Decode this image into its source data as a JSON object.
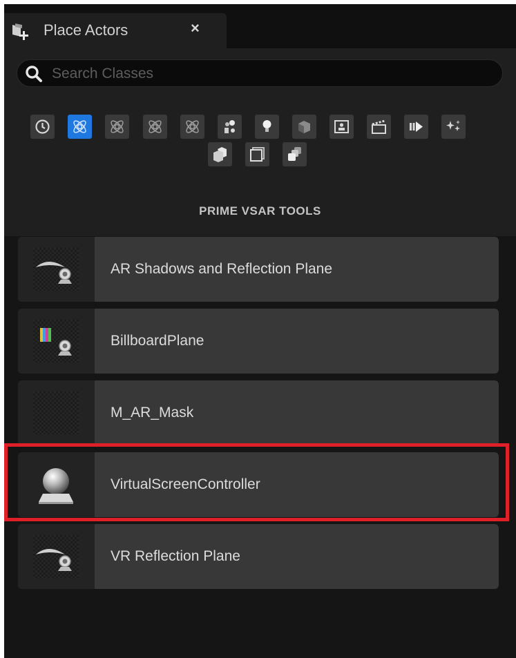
{
  "tab": {
    "title": "Place Actors",
    "close": "×",
    "icon": "place-actors-icon"
  },
  "search": {
    "placeholder": "Search Classes",
    "value": ""
  },
  "categories": [
    {
      "icon": "recently-placed-icon",
      "active": false
    },
    {
      "icon": "prime-vsar-tools-icon",
      "active": true
    },
    {
      "icon": "custom-category-icon",
      "active": false
    },
    {
      "icon": "custom-category-icon",
      "active": false
    },
    {
      "icon": "custom-category-icon",
      "active": false
    },
    {
      "icon": "basic-icon",
      "active": false
    },
    {
      "icon": "lights-icon",
      "active": false
    },
    {
      "icon": "shapes-icon",
      "active": false
    },
    {
      "icon": "cinematic-icon",
      "active": false
    },
    {
      "icon": "clapperboard-icon",
      "active": false
    },
    {
      "icon": "visual-effects-icon",
      "active": false
    },
    {
      "icon": "sparkle-icon",
      "active": false
    },
    {
      "icon": "geometry-icon",
      "active": false
    },
    {
      "icon": "volumes-icon",
      "active": false
    },
    {
      "icon": "all-classes-icon",
      "active": false
    }
  ],
  "section_title": "PRIME VSAR TOOLS",
  "items": [
    {
      "label": "AR Shadows and Reflection Plane",
      "thumbnail": "plane-actor-icon"
    },
    {
      "label": "BillboardPlane",
      "thumbnail": "billboard-actor-icon"
    },
    {
      "label": "M_AR_Mask",
      "thumbnail": "material-checker-icon"
    },
    {
      "label": "VirtualScreenController",
      "thumbnail": "sphere-actor-icon",
      "highlighted": true
    },
    {
      "label": "VR Reflection Plane",
      "thumbnail": "plane-actor-icon"
    }
  ],
  "colors": {
    "accent": "#1f78e0",
    "highlight": "#e02028",
    "panel": "#1f1f1f",
    "item": "#383838"
  }
}
